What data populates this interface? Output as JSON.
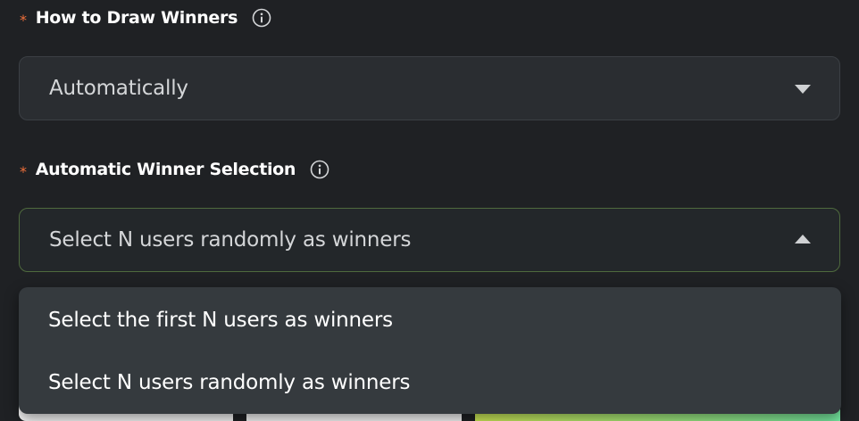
{
  "draw_method": {
    "label": "How to Draw Winners",
    "required_mark": "*",
    "value": "Automatically"
  },
  "winner_selection": {
    "label": "Automatic Winner Selection",
    "required_mark": "*",
    "value": "Select N users randomly as winners",
    "options": [
      "Select the first N users as winners",
      "Select N users randomly as winners"
    ]
  },
  "colors": {
    "background": "#1f2124",
    "field_bg": "#2a2d31",
    "dropdown_bg": "#353a3e",
    "required": "#f0703a",
    "focus_border": "#4f6a3e",
    "accent_gradient_start": "#d6f25a",
    "accent_gradient_end": "#79f0a6"
  }
}
